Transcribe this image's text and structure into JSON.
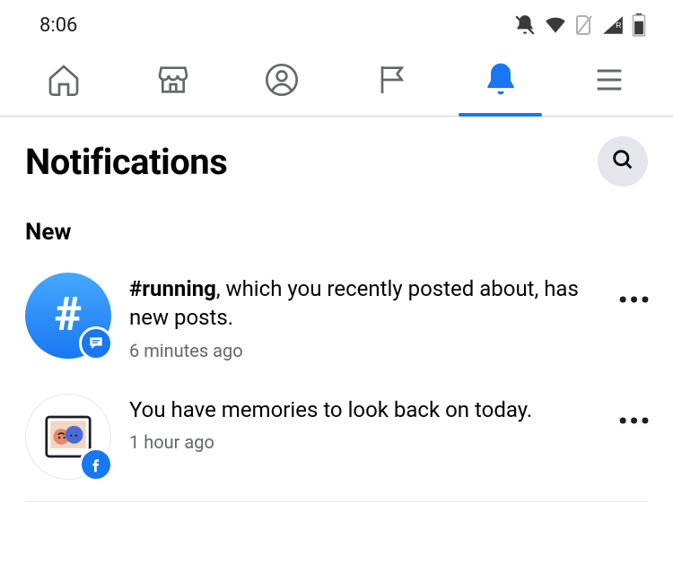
{
  "status": {
    "time": "8:06"
  },
  "tabs": {
    "home": "home",
    "marketplace": "marketplace",
    "profile": "profile",
    "pages": "pages",
    "notifications": "notifications",
    "menu": "menu",
    "active": "notifications"
  },
  "header": {
    "title": "Notifications"
  },
  "section": {
    "new_label": "New"
  },
  "notifications": [
    {
      "highlight": "#running",
      "rest": ", which you recently posted about, has new posts.",
      "time": "6 minutes ago",
      "avatar_kind": "hashtag",
      "badge_icon": "chat"
    },
    {
      "highlight": "",
      "rest": "You have memories to look back on today.",
      "time": "1 hour ago",
      "avatar_kind": "memories",
      "badge_icon": "facebook"
    }
  ],
  "glyphs": {
    "dots": "•••"
  }
}
